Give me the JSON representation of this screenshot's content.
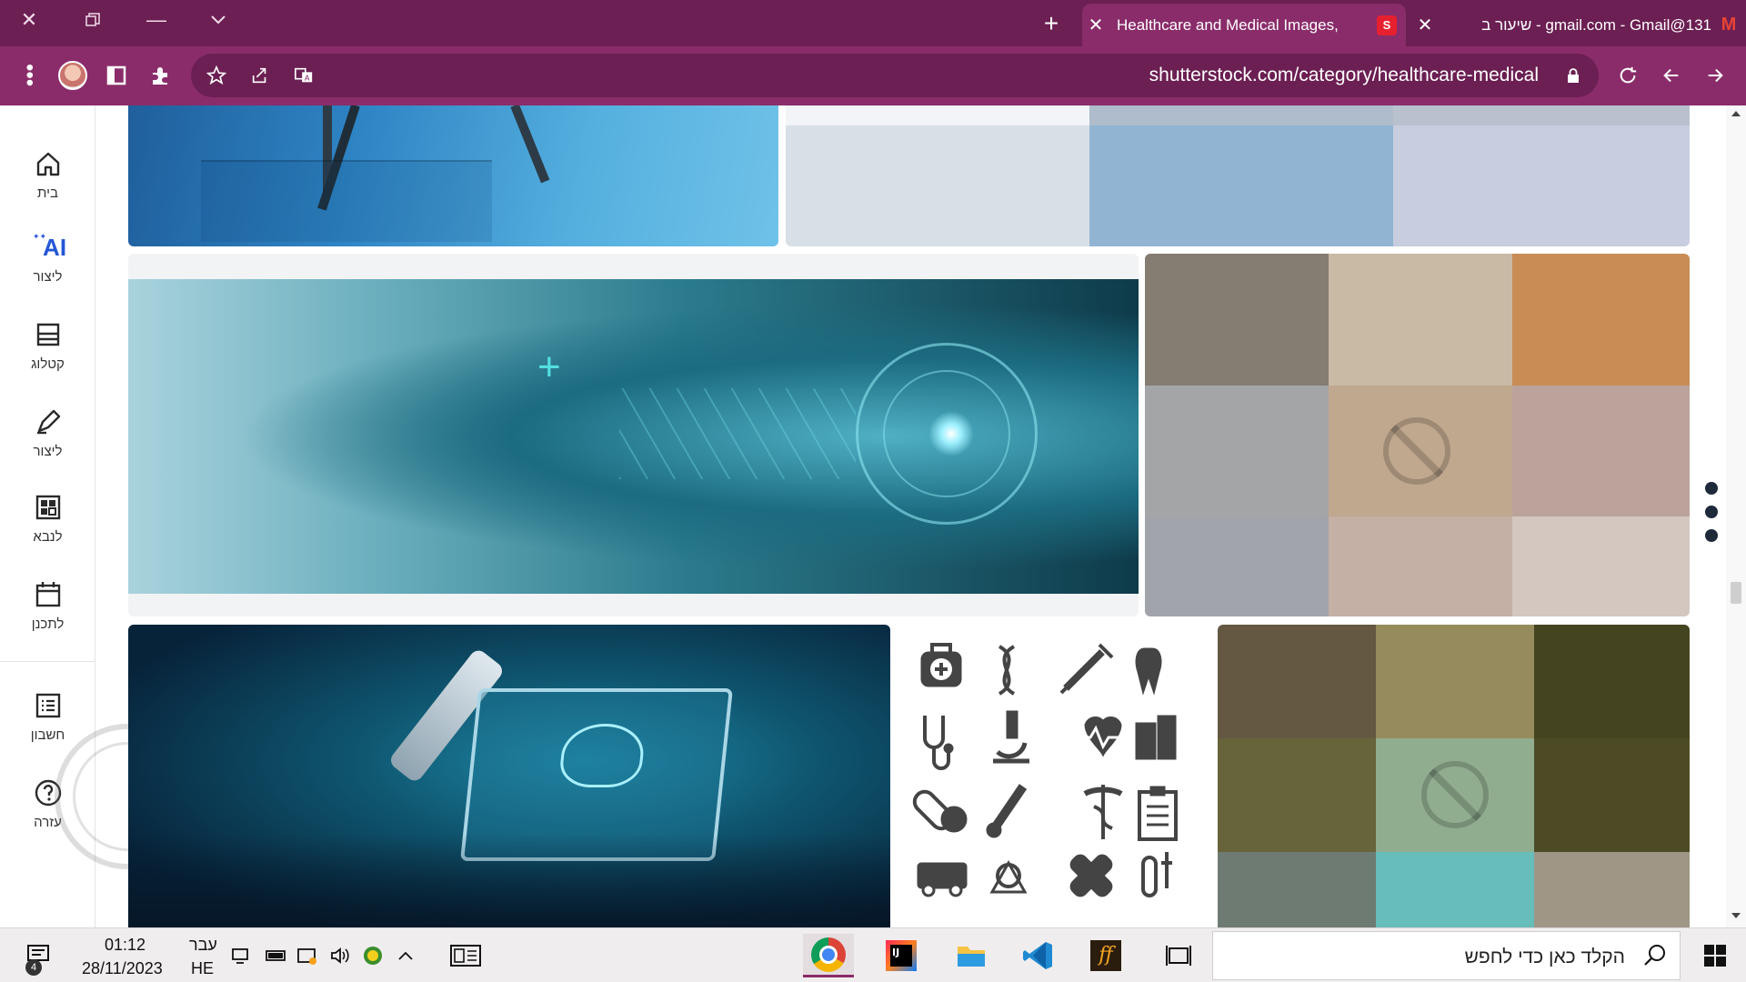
{
  "browser": {
    "tabs": [
      {
        "title": "Healthcare and Medical Images,",
        "active": true,
        "favicon": "shutterstock-favicon",
        "favicon_color": "#e6202f"
      },
      {
        "title": "131@gmail.com - Gmail - שיעור ב",
        "active": false,
        "favicon": "gmail-favicon",
        "favicon_color": "#ea4335"
      }
    ],
    "new_tab_icon": "plus-icon",
    "url": "shutterstock.com/category/healthcare-medical"
  },
  "sidebar": {
    "items": [
      {
        "label": "בית",
        "icon": "home-icon"
      },
      {
        "label": "ליצור",
        "icon": "ai-sparkle-icon",
        "icon_text": "AI"
      },
      {
        "label": "קטלוג",
        "icon": "catalog-icon"
      },
      {
        "label": "ליצור",
        "icon": "edit-icon"
      },
      {
        "label": "לנבא",
        "icon": "grid-icon"
      },
      {
        "label": "לתכנן",
        "icon": "calendar-icon"
      },
      {
        "label": "חשבון",
        "icon": "list-icon"
      },
      {
        "label": "עזרה",
        "icon": "help-icon"
      }
    ]
  },
  "colors": {
    "tab_strip": "#6b1f52",
    "toolbar": "#8a2c6a",
    "accent": "#2457d6"
  },
  "taskbar": {
    "search_placeholder": "הקלד כאן כדי לחפש",
    "time": "01:12",
    "date": "28/11/2023",
    "language_top": "עבר",
    "language_bottom": "HE",
    "notification_count": "4"
  }
}
